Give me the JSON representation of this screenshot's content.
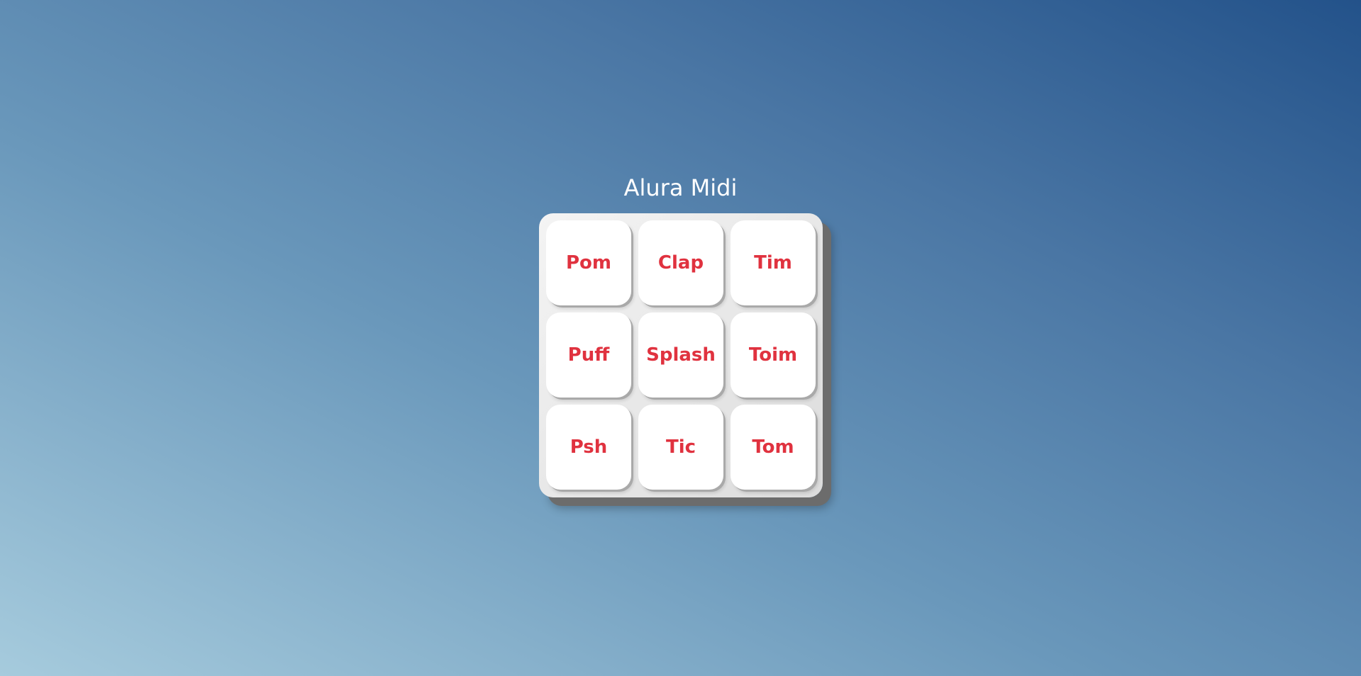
{
  "app": {
    "title": "Alura Midi"
  },
  "keys": [
    {
      "label": "Pom"
    },
    {
      "label": "Clap"
    },
    {
      "label": "Tim"
    },
    {
      "label": "Puff"
    },
    {
      "label": "Splash"
    },
    {
      "label": "Toim"
    },
    {
      "label": "Psh"
    },
    {
      "label": "Tic"
    },
    {
      "label": "Tom"
    }
  ],
  "colors": {
    "key_text": "#e0323f",
    "background_start": "#a6cbdd",
    "background_end": "#23528a",
    "key_face": "#ffffff",
    "keyboard_body": "#dcdcdc"
  }
}
